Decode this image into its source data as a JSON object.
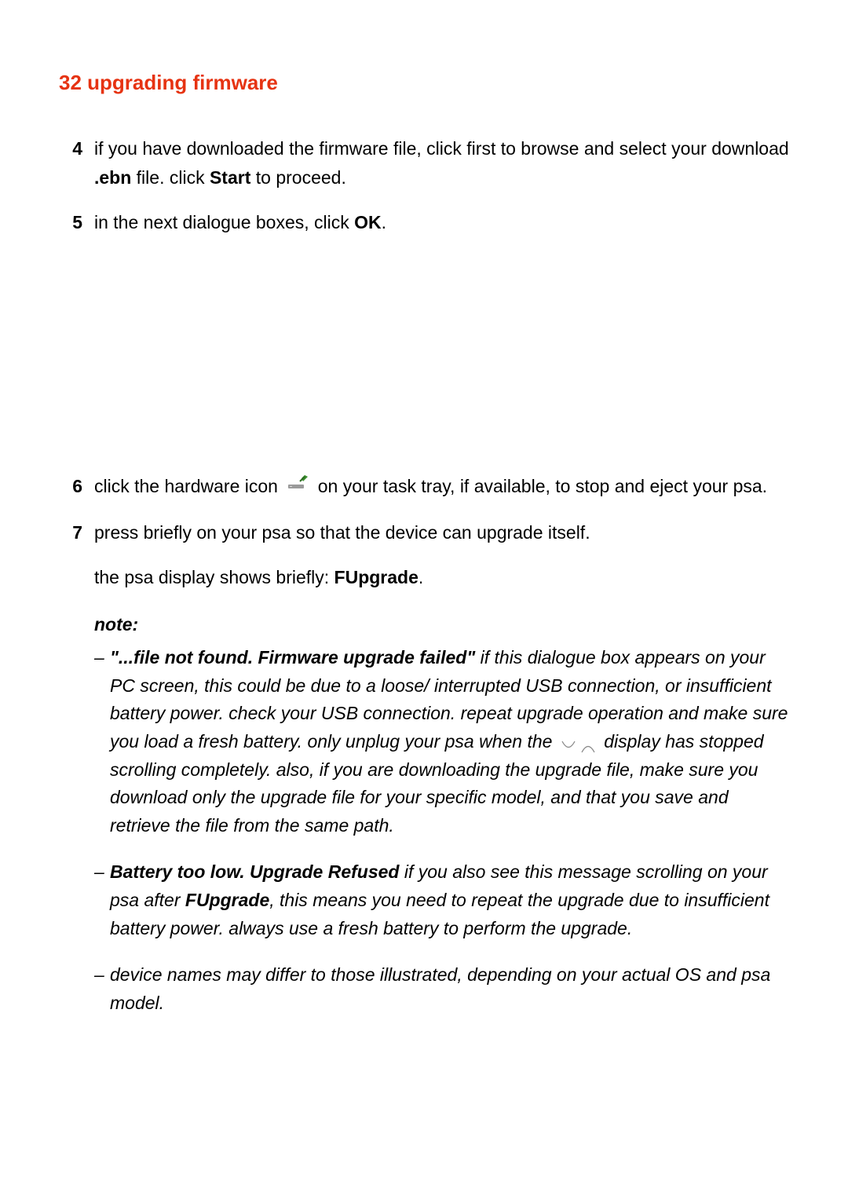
{
  "header": {
    "page_number": "32",
    "title": "upgrading firmware"
  },
  "steps": {
    "s4": {
      "num": "4",
      "part1": "if you have downloaded the firmware file, click ",
      "gap": "     ",
      "part2": " first to browse and select your download ",
      "ebn": ".ebn",
      "part3": " file. click ",
      "start": "Start",
      "part4": " to proceed."
    },
    "s5": {
      "num": "5",
      "part1": "in the next dialogue boxes, click ",
      "ok": "OK",
      "part2": "."
    },
    "s6": {
      "num": "6",
      "part1": "click the hardware icon ",
      "part2": " on your task tray, if available, to stop and eject your psa."
    },
    "s7": {
      "num": "7",
      "part1": "press ",
      "gap": "     ",
      "part2": " briefly on your psa so that the device can upgrade itself."
    },
    "s7extra": {
      "part1": "the psa display shows briefly: ",
      "fupgrade": "FUpgrade",
      "part2": "."
    }
  },
  "note": {
    "label": "note:",
    "n1": {
      "boldq": "\"...file not found. Firmware upgrade failed\"",
      "part1": " if this dialogue box appears on your PC screen, this could be due to a loose/ interrupted USB connection, or insufficient battery power. check your USB connection. repeat upgrade operation and make sure you load a fresh battery. only unplug your psa when the ",
      "part2": " display has stopped scrolling completely. also, if you are downloading the upgrade file, make sure you download only the upgrade file for your specific model, and that you save and retrieve the file from the same path."
    },
    "n2": {
      "bold1": "Battery too low. Upgrade Refused",
      "part1": " if you also see this message scrolling on your psa after ",
      "bold2": "FUpgrade",
      "part2": ", this means you need to repeat the upgrade due to insufficient battery power. always use a fresh battery to perform the upgrade."
    },
    "n3": {
      "text": "device names may differ to those illustrated, depending on your actual OS and psa model."
    }
  }
}
